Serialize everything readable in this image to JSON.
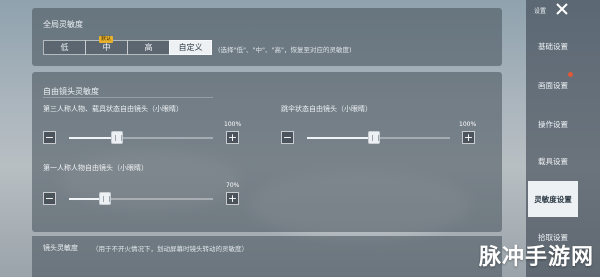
{
  "global": {
    "title": "全局灵敏度",
    "options": [
      "低",
      "中",
      "高",
      "自定义"
    ],
    "selected": "自定义",
    "recommended_tag": "默认",
    "hint": "(选择\"低\"、\"中\"、\"高\"，恢复至对应的灵敏度)"
  },
  "free_look": {
    "title": "自由镜头灵敏度",
    "sliders": [
      {
        "label": "第三人称人物、载具状态自由镜头（小眼睛）",
        "value_text": "100%",
        "value": 100
      },
      {
        "label": "跳伞状态自由镜头（小眼睛）",
        "value_text": "100%",
        "value": 100
      },
      {
        "label": "第一人称人物自由镜头（小眼睛）",
        "value_text": "70%",
        "value": 70
      }
    ]
  },
  "camera": {
    "title": "镜头灵敏度",
    "hint": "（用于不开火情况下，划动屏幕时镜头转动的灵敏度）"
  },
  "sidebar": {
    "header": "设置",
    "items": [
      {
        "label": "基础设置"
      },
      {
        "label": "画面设置"
      },
      {
        "label": "操作设置"
      },
      {
        "label": "载具设置"
      },
      {
        "label": "灵敏度设置"
      },
      {
        "label": "拾取设置"
      }
    ],
    "active": "灵敏度设置"
  },
  "watermark": "脉冲手游网",
  "colors": {
    "accent_tag": "#e7b12e",
    "notice_dot": "#e0583a"
  }
}
